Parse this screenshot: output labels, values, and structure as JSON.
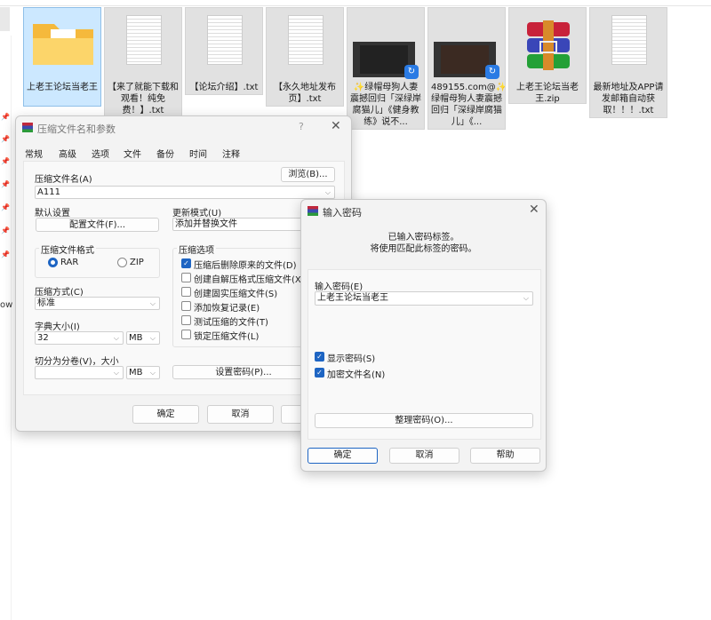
{
  "explorer": {
    "side_fragment": "ow",
    "files": [
      {
        "name": "上老王论坛当老王",
        "type": "folder",
        "selected": true
      },
      {
        "name": "【来了就能下载和观看！纯免费！】.txt",
        "type": "text"
      },
      {
        "name": "【论坛介绍】.txt",
        "type": "text"
      },
      {
        "name": "【永久地址发布页】.txt",
        "type": "text"
      },
      {
        "name": "✨绿帽母狗人妻震撼回归「深绿岸腐猫儿」《健身教练》说不...",
        "type": "video"
      },
      {
        "name": "489155.com@✨绿帽母狗人妻震撼回归「深绿岸腐猫儿」《...",
        "type": "video"
      },
      {
        "name": "上老王论坛当老王.zip",
        "type": "archive"
      },
      {
        "name": "最新地址及APP请发邮箱自动获取！！！.txt",
        "type": "text"
      }
    ]
  },
  "archive_dialog": {
    "title": "压缩文件名和参数",
    "help": "?",
    "tabs": [
      "常规",
      "高级",
      "选项",
      "文件",
      "备份",
      "时间",
      "注释"
    ],
    "active_tab": "常规",
    "archive_name_label": "压缩文件名(A)",
    "browse_button": "浏览(B)...",
    "archive_name_value": "A111",
    "default_settings_label": "默认设置",
    "profiles_button": "配置文件(F)...",
    "update_mode_label": "更新模式(U)",
    "update_mode_value": "添加并替换文件",
    "format_group": "压缩文件格式",
    "format_rar": "RAR",
    "format_zip": "ZIP",
    "selected_format": "RAR",
    "method_label": "压缩方式(C)",
    "method_value": "标准",
    "dict_label": "字典大小(I)",
    "dict_value": "32",
    "dict_unit": "MB",
    "split_label": "切分为分卷(V)，大小",
    "split_value": "",
    "split_unit": "MB",
    "options_group": "压缩选项",
    "options": [
      {
        "label": "压缩后删除原来的文件(D)",
        "checked": true
      },
      {
        "label": "创建自解压格式压缩文件(X)",
        "checked": false
      },
      {
        "label": "创建固实压缩文件(S)",
        "checked": false
      },
      {
        "label": "添加恢复记录(E)",
        "checked": false
      },
      {
        "label": "测试压缩的文件(T)",
        "checked": false
      },
      {
        "label": "锁定压缩文件(L)",
        "checked": false
      }
    ],
    "set_password_button": "设置密码(P)...",
    "ok_button": "确定",
    "cancel_button": "取消"
  },
  "password_dialog": {
    "title": "输入密码",
    "info_line1": "已输入密码标签。",
    "info_line2": "将使用匹配此标签的密码。",
    "password_label": "输入密码(E)",
    "password_value": "上老王论坛当老王",
    "show_password": {
      "label": "显示密码(S)",
      "checked": true
    },
    "encrypt_names": {
      "label": "加密文件名(N)",
      "checked": true
    },
    "organize_button": "整理密码(O)...",
    "ok_button": "确定",
    "cancel_button": "取消",
    "help_button": "帮助"
  }
}
